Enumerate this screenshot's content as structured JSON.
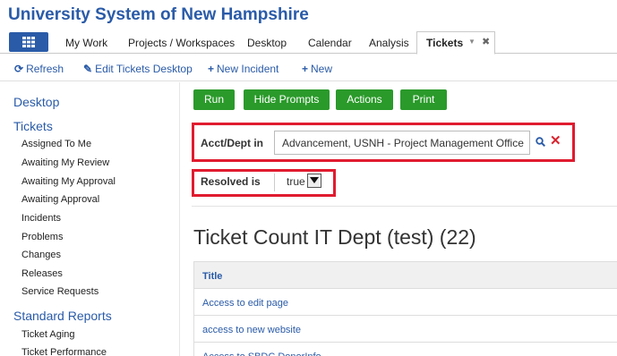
{
  "org": {
    "title": "University System of New Hampshire"
  },
  "tabs": {
    "items": [
      "My Work",
      "Projects / Workspaces",
      "Desktop",
      "Calendar",
      "Analysis"
    ],
    "active": "Tickets"
  },
  "toolbar": {
    "refresh": "Refresh",
    "edit_desktop": "Edit Tickets Desktop",
    "new_incident": "New Incident",
    "new": "New"
  },
  "sidebar": {
    "desktop": "Desktop",
    "tickets": "Tickets",
    "ticket_items": [
      "Assigned To Me",
      "Awaiting My Review",
      "Awaiting My Approval",
      "Awaiting Approval",
      "Incidents",
      "Problems",
      "Changes",
      "Releases",
      "Service Requests"
    ],
    "standard_reports": "Standard Reports",
    "report_items": [
      "Ticket Aging",
      "Ticket Performance"
    ]
  },
  "actions": {
    "run": "Run",
    "hide_prompts": "Hide Prompts",
    "actions": "Actions",
    "print": "Print"
  },
  "prompts": {
    "acct_label": "Acct/Dept in",
    "acct_value": "Advancement, USNH - Project Management Office",
    "resolved_label": "Resolved is",
    "resolved_value": "true"
  },
  "report": {
    "title": "Ticket Count IT Dept (test) (22)",
    "column": "Title",
    "rows": [
      "Access to edit page",
      "access to new website",
      "Access to SBDC DonorInfo"
    ]
  },
  "colors": {
    "brand": "#2a5ba8",
    "action": "#2a9a2a",
    "highlight": "#e01b2f"
  }
}
